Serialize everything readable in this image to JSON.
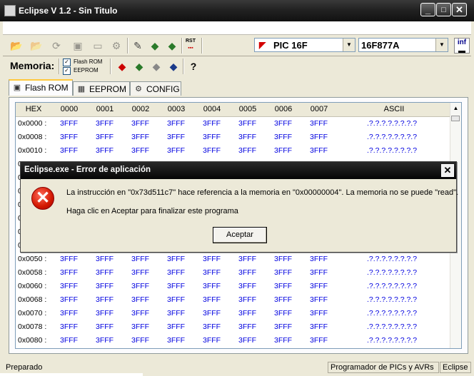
{
  "window": {
    "title": "Eclipse V 1.2 - Sin Titulo",
    "controls": {
      "minimize": "_",
      "maximize": "□",
      "close": "✕"
    }
  },
  "toolbar": {
    "buttons": [
      "open-folder-icon",
      "open-folder2-icon",
      "refresh-icon",
      "save-icon",
      "monitor-icon",
      "gear-icon",
      "script-icon",
      "chip-read-icon",
      "chip-write-icon",
      "rst-icon"
    ],
    "rst_label": "RST",
    "family_select": {
      "value": "PIC 16F"
    },
    "device_select": {
      "value": "16F877A"
    },
    "info_label": "inf"
  },
  "memory_bar": {
    "label": "Memoria:",
    "flash_rom": {
      "label": "Flash ROM",
      "checked": true
    },
    "eeprom": {
      "label": "EEPROM",
      "checked": true
    }
  },
  "tabs": [
    {
      "label": "Flash ROM",
      "active": true,
      "icon": "chip-icon"
    },
    {
      "label": "EEPROM",
      "active": false,
      "icon": "grid-icon"
    },
    {
      "label": "CONFIG",
      "active": false,
      "icon": "gear-icon"
    }
  ],
  "grid": {
    "headers": [
      "HEX",
      "0000",
      "0001",
      "0002",
      "0003",
      "0004",
      "0005",
      "0006",
      "0007",
      "ASCII"
    ],
    "rows_top": [
      {
        "addr": "0x0000 :",
        "values": [
          "3FFF",
          "3FFF",
          "3FFF",
          "3FFF",
          "3FFF",
          "3FFF",
          "3FFF",
          "3FFF"
        ],
        "ascii": ".?.?.?.?.?.?.?.?"
      },
      {
        "addr": "0x0008 :",
        "values": [
          "3FFF",
          "3FFF",
          "3FFF",
          "3FFF",
          "3FFF",
          "3FFF",
          "3FFF",
          "3FFF"
        ],
        "ascii": ".?.?.?.?.?.?.?.?"
      },
      {
        "addr": "0x0010 :",
        "values": [
          "3FFF",
          "3FFF",
          "3FFF",
          "3FFF",
          "3FFF",
          "3FFF",
          "3FFF",
          "3FFF"
        ],
        "ascii": ".?.?.?.?.?.?.?.?"
      }
    ],
    "rows_bottom": [
      {
        "addr": "0x0050 :",
        "values": [
          "3FFF",
          "3FFF",
          "3FFF",
          "3FFF",
          "3FFF",
          "3FFF",
          "3FFF",
          "3FFF"
        ],
        "ascii": ".?.?.?.?.?.?.?.?"
      },
      {
        "addr": "0x0058 :",
        "values": [
          "3FFF",
          "3FFF",
          "3FFF",
          "3FFF",
          "3FFF",
          "3FFF",
          "3FFF",
          "3FFF"
        ],
        "ascii": ".?.?.?.?.?.?.?.?"
      },
      {
        "addr": "0x0060 :",
        "values": [
          "3FFF",
          "3FFF",
          "3FFF",
          "3FFF",
          "3FFF",
          "3FFF",
          "3FFF",
          "3FFF"
        ],
        "ascii": ".?.?.?.?.?.?.?.?"
      },
      {
        "addr": "0x0068 :",
        "values": [
          "3FFF",
          "3FFF",
          "3FFF",
          "3FFF",
          "3FFF",
          "3FFF",
          "3FFF",
          "3FFF"
        ],
        "ascii": ".?.?.?.?.?.?.?.?"
      },
      {
        "addr": "0x0070 :",
        "values": [
          "3FFF",
          "3FFF",
          "3FFF",
          "3FFF",
          "3FFF",
          "3FFF",
          "3FFF",
          "3FFF"
        ],
        "ascii": ".?.?.?.?.?.?.?.?"
      },
      {
        "addr": "0x0078 :",
        "values": [
          "3FFF",
          "3FFF",
          "3FFF",
          "3FFF",
          "3FFF",
          "3FFF",
          "3FFF",
          "3FFF"
        ],
        "ascii": ".?.?.?.?.?.?.?.?"
      },
      {
        "addr": "0x0080 :",
        "values": [
          "3FFF",
          "3FFF",
          "3FFF",
          "3FFF",
          "3FFF",
          "3FFF",
          "3FFF",
          "3FFF"
        ],
        "ascii": ".?.?.?.?.?.?.?.?"
      }
    ],
    "hidden_addr_prefix": "0"
  },
  "status": {
    "left": "Preparado",
    "middle": "Programador de PICs y AVRs",
    "right": "Eclipse"
  },
  "dialog": {
    "title": "Eclipse.exe - Error de aplicación",
    "message1": "La instrucción en \"0x73d511c7\" hace referencia a la memoria en \"0x00000004\". La memoria no se puede \"read\".",
    "message2": "Haga clic en Aceptar para finalizar este programa",
    "ok_label": "Aceptar",
    "close_glyph": "✕",
    "icon_glyph": "✕"
  }
}
